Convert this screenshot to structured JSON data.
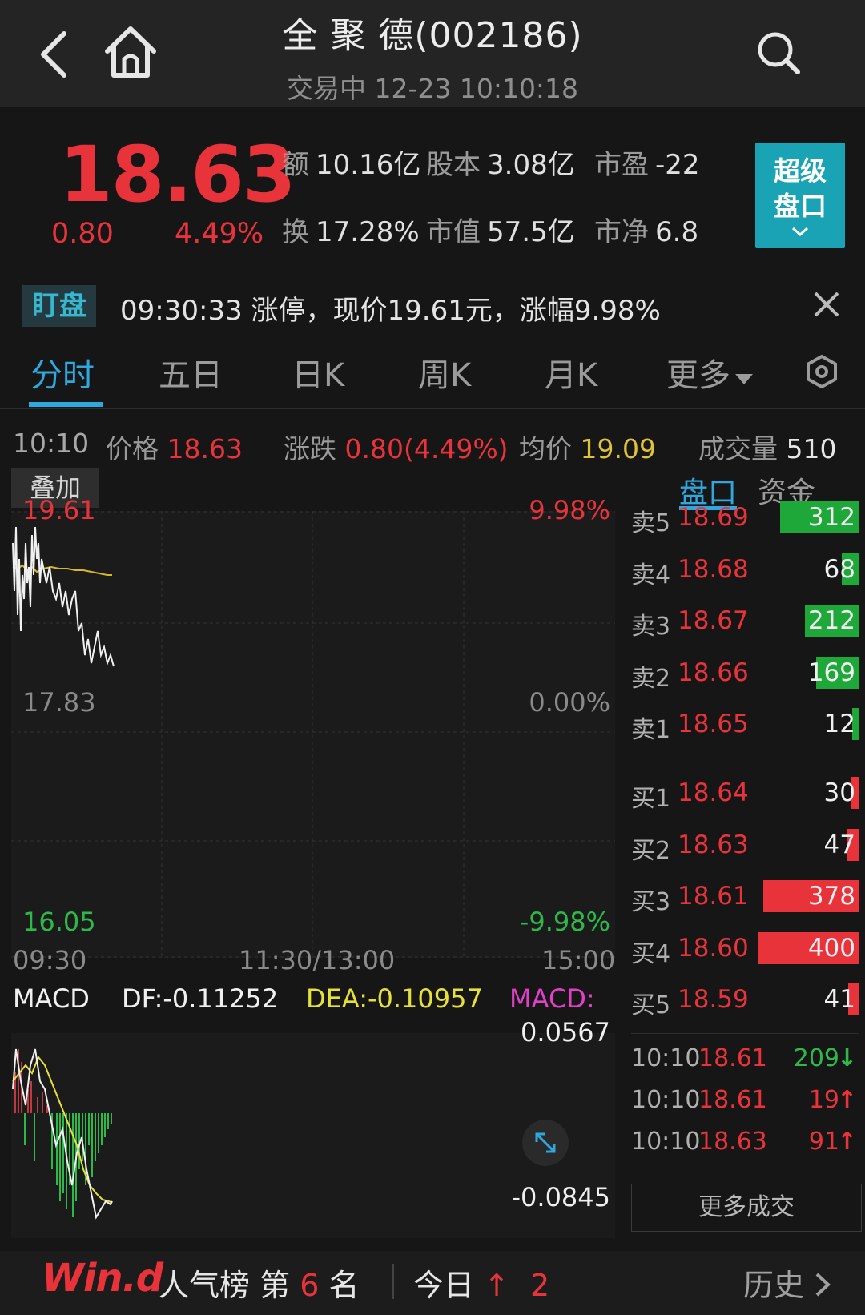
{
  "header": {
    "title": "全 聚 德(002186)",
    "status": "交易中",
    "datetime": "12-23 10:10:18"
  },
  "quote": {
    "price": "18.63",
    "change": "0.80",
    "change_pct": "4.49%",
    "stats": [
      {
        "label": "额",
        "value": "10.16亿"
      },
      {
        "label": "股本",
        "value": "3.08亿"
      },
      {
        "label": "市盈",
        "value": "-22"
      },
      {
        "label": "换",
        "value": "17.28%"
      },
      {
        "label": "市值",
        "value": "57.5亿"
      },
      {
        "label": "市净",
        "value": "6.8"
      }
    ],
    "super_button": [
      "超级",
      "盘口"
    ]
  },
  "alert": {
    "tag": "盯盘",
    "text": "09:30:33 涨停，现价19.61元，涨幅9.98%"
  },
  "tabs": [
    "分时",
    "五日",
    "日K",
    "周K",
    "月K",
    "更多"
  ],
  "info_row": {
    "time": "10:10",
    "price_label": "价格",
    "price": "18.63",
    "change_label": "涨跌",
    "change": "0.80(4.49%)",
    "avg_label": "均价",
    "avg": "19.09",
    "volume_label": "成交量",
    "volume": "510"
  },
  "overlay_button": "叠加",
  "subtabs": [
    "盘口",
    "资金"
  ],
  "chart": {
    "price_high": "19.61",
    "price_mid": "17.83",
    "price_low": "16.05",
    "pct_high": "9.98%",
    "pct_mid": "0.00%",
    "pct_low": "-9.98%",
    "time_start": "09:30",
    "time_mid": "11:30/13:00",
    "time_end": "15:00"
  },
  "macd": {
    "title": "MACD",
    "df": "DF:-0.11252",
    "dea": "DEA:-0.10957",
    "macd": "MACD:",
    "max": "0.0567",
    "min": "-0.0845"
  },
  "colors": {
    "up": "#e8333b",
    "down": "#2fb84a",
    "accent": "#2fa8e0",
    "avg_line": "#d9b52a",
    "macd_pink": "#e040c8"
  },
  "order_book": {
    "asks": [
      {
        "label": "卖5",
        "price": "18.69",
        "volume": 312
      },
      {
        "label": "卖4",
        "price": "18.68",
        "volume": 68
      },
      {
        "label": "卖3",
        "price": "18.67",
        "volume": 212
      },
      {
        "label": "卖2",
        "price": "18.66",
        "volume": 169
      },
      {
        "label": "卖1",
        "price": "18.65",
        "volume": 12
      }
    ],
    "bids": [
      {
        "label": "买1",
        "price": "18.64",
        "volume": 30
      },
      {
        "label": "买2",
        "price": "18.63",
        "volume": 47
      },
      {
        "label": "买3",
        "price": "18.61",
        "volume": 378
      },
      {
        "label": "买4",
        "price": "18.60",
        "volume": 400
      },
      {
        "label": "买5",
        "price": "18.59",
        "volume": 41
      }
    ]
  },
  "trades": [
    {
      "time": "10:10",
      "price": "18.61",
      "volume": "209",
      "dir": "↓"
    },
    {
      "time": "10:10",
      "price": "18.61",
      "volume": "19",
      "dir": "↑"
    },
    {
      "time": "10:10",
      "price": "18.63",
      "volume": "91",
      "dir": "↑"
    }
  ],
  "more_trades": "更多成交",
  "footer": {
    "logo": "Win.d",
    "rank_text": "人气榜 第",
    "rank": "6",
    "rank_suffix": "名",
    "today_label": "今日",
    "today_arrow": "↑",
    "today_value": "2",
    "history": "历史"
  }
}
